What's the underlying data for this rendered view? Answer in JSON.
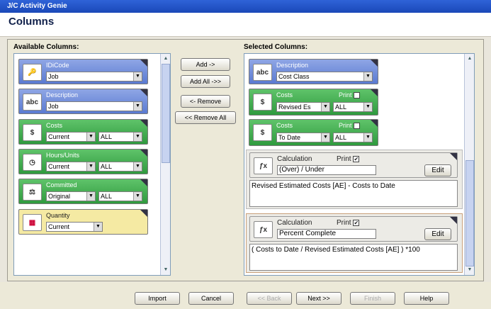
{
  "window": {
    "title": "J/C Activity Genie"
  },
  "page": {
    "heading": "Columns"
  },
  "available": {
    "title": "Available Columns:",
    "cards": [
      {
        "label": "IDiCode",
        "select": "Job"
      },
      {
        "label": "Description",
        "select": "Job"
      },
      {
        "label": "Costs",
        "select1": "Current",
        "select2": "ALL"
      },
      {
        "label": "Hours/Units",
        "select1": "Current",
        "select2": "ALL"
      },
      {
        "label": "Committed",
        "select1": "Original",
        "select2": "ALL"
      },
      {
        "label": "Quantity",
        "select": "Current"
      }
    ]
  },
  "actions": {
    "add": "Add ->",
    "add_all": "Add All ->>",
    "remove": "<- Remove",
    "remove_all": "<< Remove All"
  },
  "selected": {
    "title": "Selected Columns:",
    "cards": [
      {
        "label": "Description",
        "select": "Cost Class"
      },
      {
        "label": "Costs",
        "print": "Print",
        "select1": "Revised Es",
        "select2": "ALL"
      },
      {
        "label": "Costs",
        "print": "Print",
        "select1": "To Date",
        "select2": "ALL"
      },
      {
        "label": "Calculation",
        "print": "Print",
        "name": "(Over) / Under",
        "edit": "Edit",
        "formula": "Revised Estimated Costs [AE] - Costs to Date"
      },
      {
        "label": "Calculation",
        "print": "Print",
        "name": "Percent Complete",
        "edit": "Edit",
        "formula": "( Costs to Date / Revised Estimated Costs [AE] ) *100"
      }
    ]
  },
  "footer": {
    "import": "Import",
    "cancel": "Cancel",
    "back": "<< Back",
    "next": "Next >>",
    "finish": "Finish",
    "help": "Help"
  }
}
